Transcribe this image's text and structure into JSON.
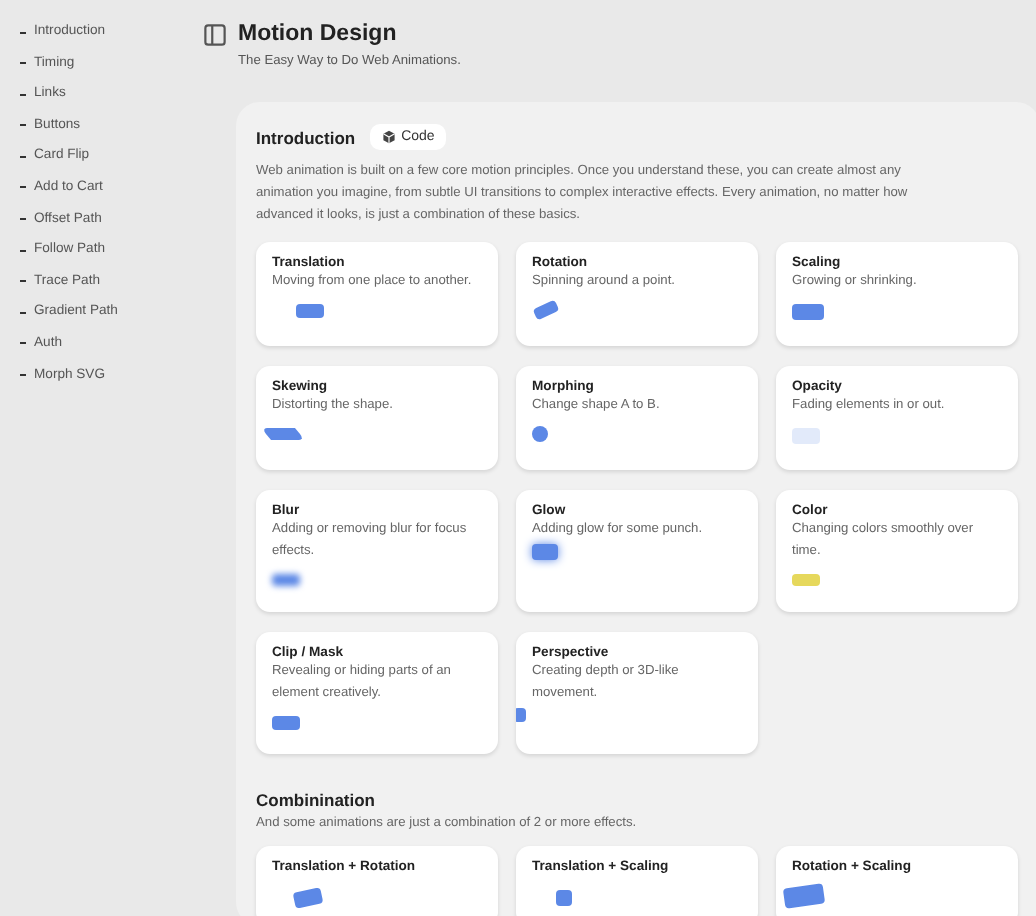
{
  "sidebar": {
    "items": [
      {
        "label": "Introduction"
      },
      {
        "label": "Timing"
      },
      {
        "label": "Links"
      },
      {
        "label": "Buttons"
      },
      {
        "label": "Card Flip"
      },
      {
        "label": "Add to Cart"
      },
      {
        "label": "Offset Path"
      },
      {
        "label": "Follow Path"
      },
      {
        "label": "Trace Path"
      },
      {
        "label": "Gradient Path"
      },
      {
        "label": "Auth"
      },
      {
        "label": "Morph SVG"
      }
    ]
  },
  "header": {
    "title": "Motion Design",
    "subtitle": "The Easy Way to Do Web Animations."
  },
  "introduction": {
    "title": "Introduction",
    "code_button": "Code",
    "text": "Web animation is built on a few core motion principles. Once you understand these, you can create almost any animation you imagine, from subtle UI transitions to complex interactive effects. Every animation, no matter how advanced it looks, is just a combination of these basics.",
    "cards": [
      {
        "title": "Translation",
        "description": "Moving from one place to another.",
        "kind": "translation"
      },
      {
        "title": "Rotation",
        "description": "Spinning around a point.",
        "kind": "rotation"
      },
      {
        "title": "Scaling",
        "description": "Growing or shrinking.",
        "kind": "scaling"
      },
      {
        "title": "Skewing",
        "description": "Distorting the shape.",
        "kind": "skewing"
      },
      {
        "title": "Morphing",
        "description": "Change shape A to B.",
        "kind": "morphing"
      },
      {
        "title": "Opacity",
        "description": "Fading elements in or out.",
        "kind": "opacity"
      },
      {
        "title": "Blur",
        "description": "Adding or removing blur for focus effects.",
        "kind": "blur"
      },
      {
        "title": "Glow",
        "description": "Adding glow for some punch.",
        "kind": "glow"
      },
      {
        "title": "Color",
        "description": "Changing colors smoothly over time.",
        "kind": "color"
      },
      {
        "title": "Clip / Mask",
        "description": "Revealing or hiding parts of an element creatively.",
        "kind": "clip"
      },
      {
        "title": "Perspective",
        "description": "Creating depth or 3D-like movement.",
        "kind": "perspective"
      }
    ]
  },
  "combination": {
    "title": "Combinination",
    "text": "And some animations are just a combination of 2 or more effects.",
    "cards": [
      {
        "title": "Translation + Rotation",
        "kind": "translation-rotation"
      },
      {
        "title": "Translation + Scaling",
        "kind": "translation-scaling"
      },
      {
        "title": "Rotation + Scaling",
        "kind": "rotation-scaling"
      }
    ]
  }
}
